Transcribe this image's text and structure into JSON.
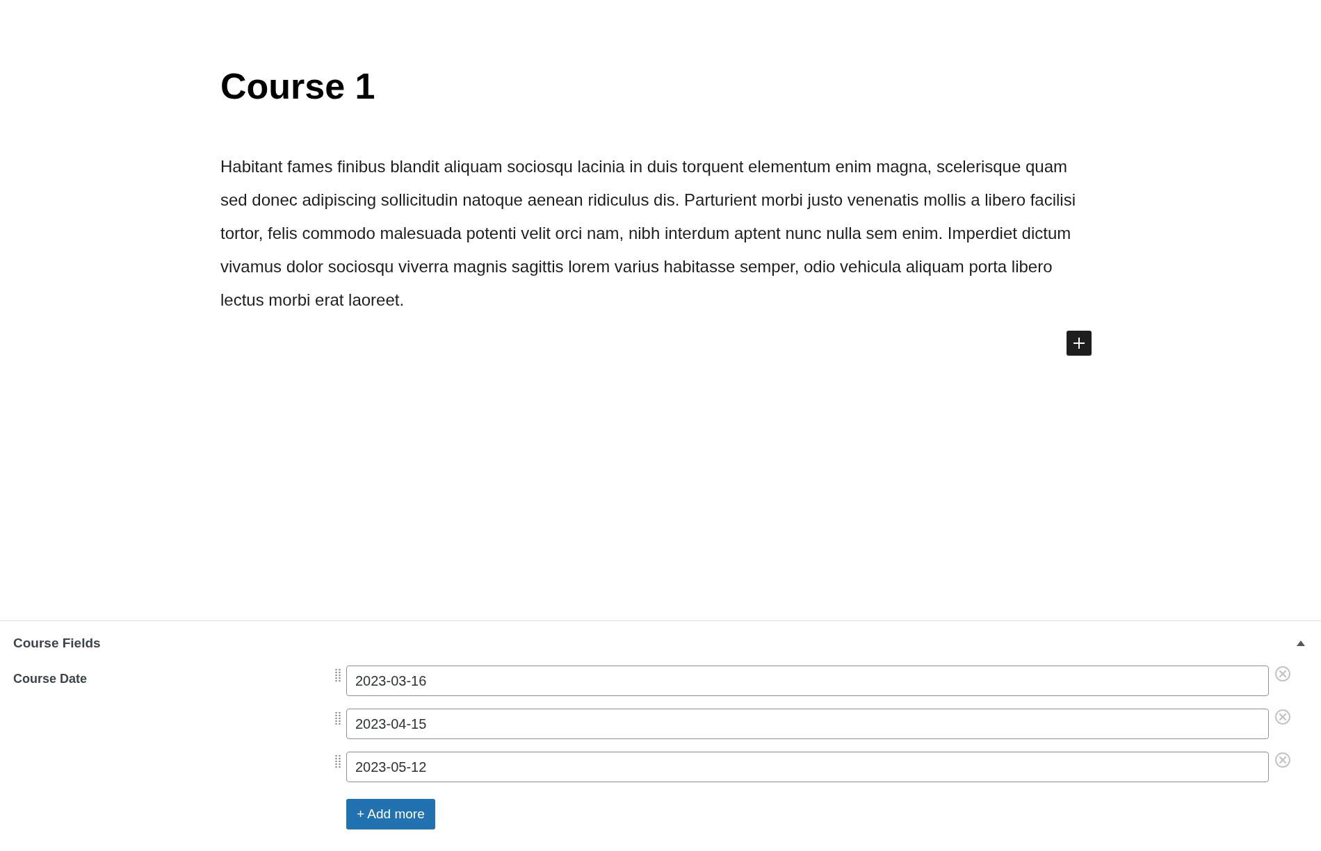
{
  "post": {
    "title": "Course 1",
    "body": "Habitant fames finibus blandit aliquam sociosqu lacinia in duis torquent elementum enim magna, scelerisque quam sed donec adipiscing sollicitudin natoque aenean ridiculus dis. Parturient morbi justo venenatis mollis a libero facilisi tortor, felis commodo malesuada potenti velit orci nam, nibh interdum aptent nunc nulla sem enim. Imperdiet dictum vivamus dolor sociosqu viverra magnis sagittis lorem varius habitasse semper, odio vehicula aliquam porta libero lectus morbi erat laoreet."
  },
  "metabox": {
    "title": "Course Fields",
    "expanded": true,
    "field": {
      "label": "Course Date",
      "values": [
        {
          "value": "2023-03-16"
        },
        {
          "value": "2023-04-15"
        },
        {
          "value": "2023-05-12"
        }
      ],
      "add_button": "+ Add more"
    }
  }
}
